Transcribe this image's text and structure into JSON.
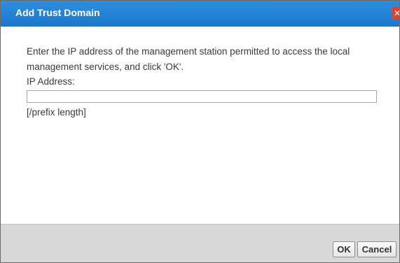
{
  "dialog": {
    "title": "Add Trust Domain",
    "close_glyph": "✕"
  },
  "form": {
    "instruction": "Enter the IP address of the management station permitted to access the local management services, and click 'OK'.",
    "ip_label": "IP Address:",
    "ip_value": "",
    "ip_placeholder": "",
    "prefix_hint": "[/prefix length]"
  },
  "buttons": {
    "ok_label": "OK",
    "cancel_label": "Cancel"
  },
  "colors": {
    "titlebar": "#1a78cc",
    "close": "#e2402b",
    "footer": "#d8d8d8"
  }
}
